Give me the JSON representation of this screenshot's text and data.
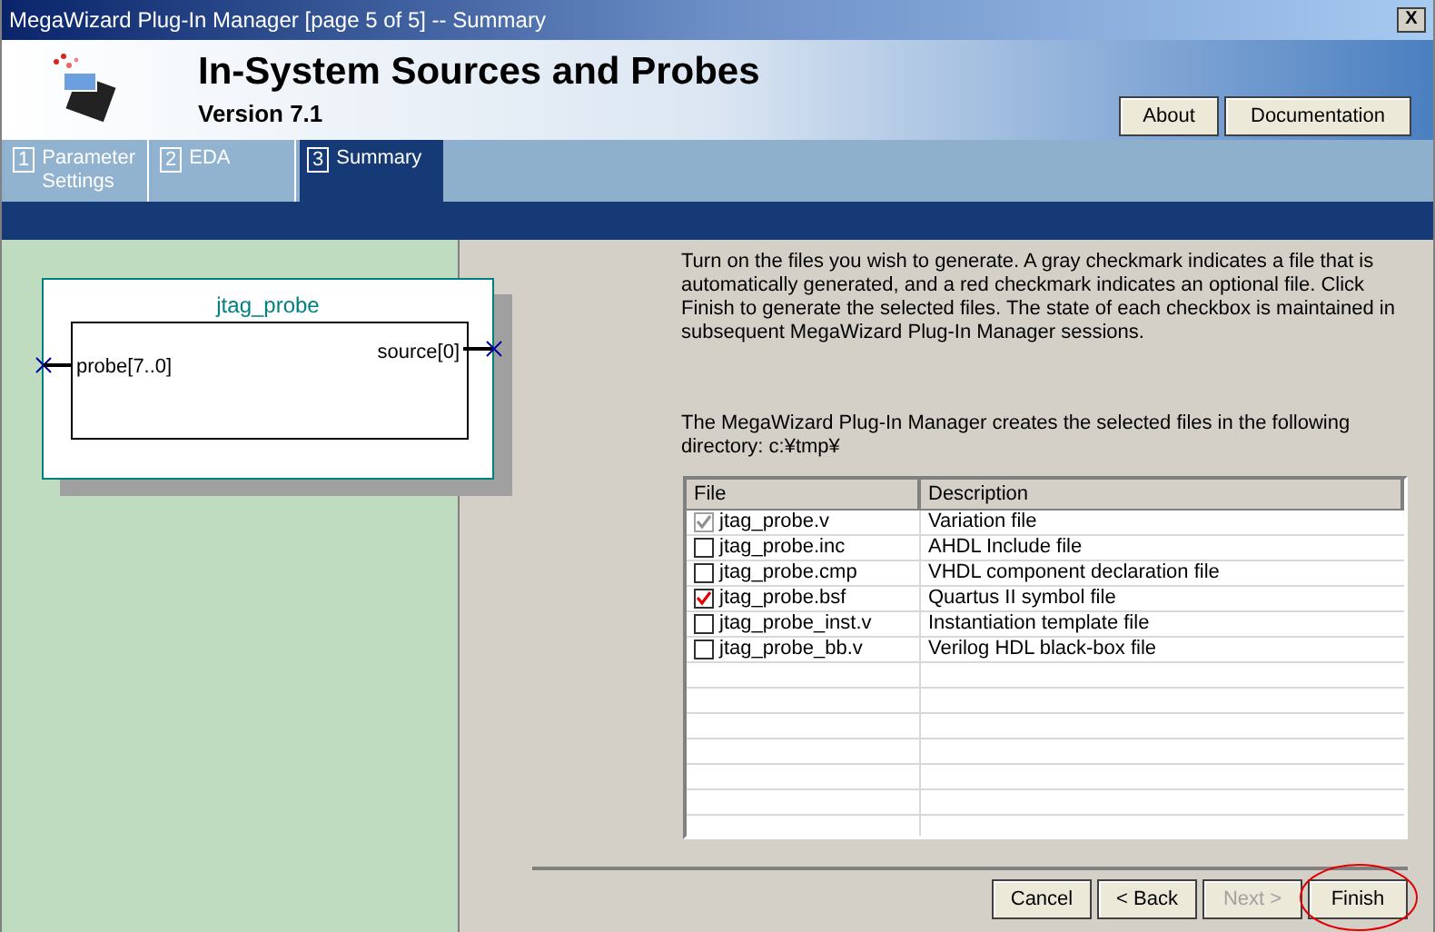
{
  "window": {
    "title": "MegaWizard Plug-In Manager [page 5 of 5] -- Summary",
    "close": "X"
  },
  "header": {
    "title": "In-System Sources and Probes",
    "version": "Version 7.1",
    "buttons": [
      "About",
      "Documentation"
    ]
  },
  "tabs": [
    {
      "number": "1",
      "label": "Parameter Settings",
      "selected": false
    },
    {
      "number": "2",
      "label": "EDA",
      "selected": false
    },
    {
      "number": "3",
      "label": "Summary",
      "selected": true
    }
  ],
  "symbol": {
    "name": "jtag_probe",
    "input": "probe[7..0]",
    "output": "source[0]"
  },
  "instructions": "Turn on the files you wish to generate. A gray checkmark indicates a file that is automatically generated, and a red checkmark indicates an optional file. Click Finish to generate the selected files. The state of each checkbox is maintained in subsequent MegaWizard Plug-In Manager sessions.",
  "directory_note": "The MegaWizard Plug-In Manager creates the selected files in the following directory: c:¥tmp¥",
  "table": {
    "columns": [
      "File",
      "Description"
    ],
    "rows": [
      {
        "file": "jtag_probe.v",
        "description": "Variation file",
        "checked": true,
        "disabled": true
      },
      {
        "file": "jtag_probe.inc",
        "description": "AHDL Include file",
        "checked": false,
        "disabled": false
      },
      {
        "file": "jtag_probe.cmp",
        "description": "VHDL component declaration file",
        "checked": false,
        "disabled": false
      },
      {
        "file": "jtag_probe.bsf",
        "description": "Quartus II symbol file",
        "checked": true,
        "disabled": false
      },
      {
        "file": "jtag_probe_inst.v",
        "description": "Instantiation template file",
        "checked": false,
        "disabled": false
      },
      {
        "file": "jtag_probe_bb.v",
        "description": "Verilog HDL black-box file",
        "checked": false,
        "disabled": false
      }
    ]
  },
  "buttons": [
    {
      "label": "Cancel",
      "disabled": false
    },
    {
      "label": "< Back",
      "disabled": false
    },
    {
      "label": "Next >",
      "disabled": true
    },
    {
      "label": "Finish",
      "disabled": false
    }
  ]
}
